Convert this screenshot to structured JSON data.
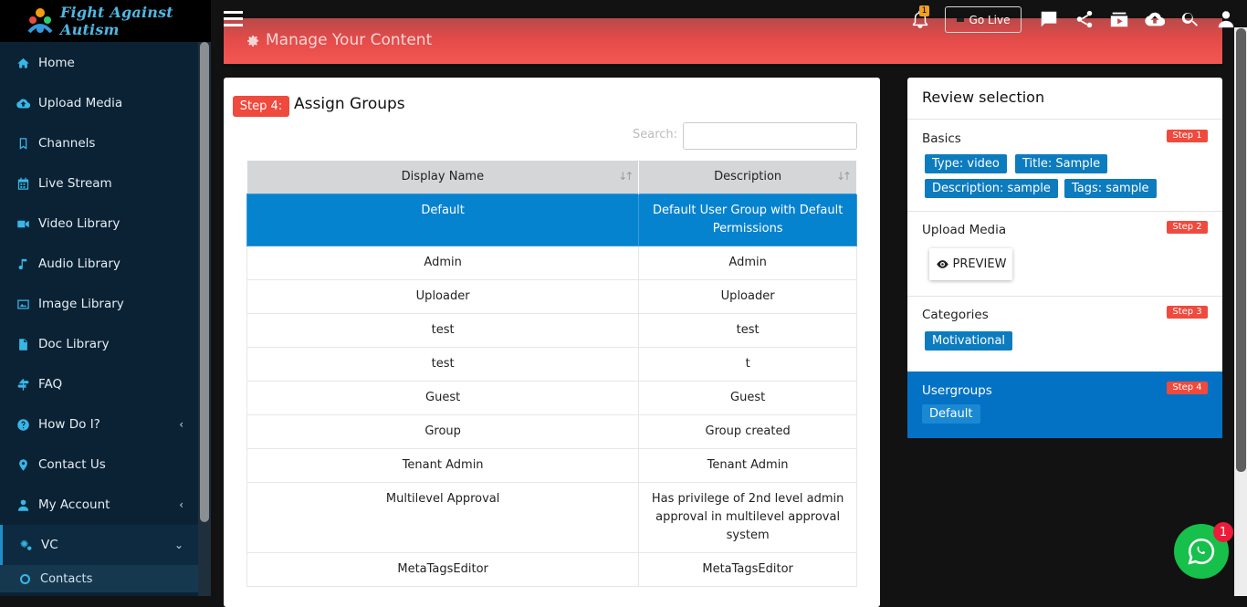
{
  "app": {
    "logo_text": "Fight Against Autism"
  },
  "sidebar": {
    "items": [
      {
        "label": "Home",
        "icon": "home-icon"
      },
      {
        "label": "Upload Media",
        "icon": "cloud-upload-icon"
      },
      {
        "label": "Channels",
        "icon": "bookmark-icon"
      },
      {
        "label": "Live Stream",
        "icon": "calendar-icon"
      },
      {
        "label": "Video Library",
        "icon": "video-camera-icon"
      },
      {
        "label": "Audio Library",
        "icon": "music-icon"
      },
      {
        "label": "Image Library",
        "icon": "image-icon"
      },
      {
        "label": "Doc Library",
        "icon": "document-icon"
      },
      {
        "label": "FAQ",
        "icon": "signpost-icon"
      },
      {
        "label": "How Do I?",
        "icon": "question-icon",
        "chevron": "‹"
      },
      {
        "label": "Contact Us",
        "icon": "map-marker-icon"
      },
      {
        "label": "My Account",
        "icon": "user-icon",
        "chevron": "‹"
      },
      {
        "label": "VC",
        "icon": "cogs-icon",
        "chevron": "⌄"
      }
    ],
    "sub_item": "Contacts"
  },
  "topbar": {
    "notification_count": "1",
    "go_live_label": "Go Live"
  },
  "header": {
    "title": "Manage Your Content"
  },
  "step": {
    "badge": "Step 4:",
    "title": "Assign Groups",
    "search_label": "Search:",
    "search_value": ""
  },
  "table": {
    "headers": [
      "Display Name",
      "Description"
    ],
    "rows": [
      {
        "name": "Default",
        "desc": "Default User Group with Default Permissions",
        "selected": true
      },
      {
        "name": "Admin",
        "desc": "Admin"
      },
      {
        "name": "Uploader",
        "desc": "Uploader"
      },
      {
        "name": "test",
        "desc": "test"
      },
      {
        "name": "test",
        "desc": "t"
      },
      {
        "name": "Guest",
        "desc": "Guest"
      },
      {
        "name": "Group",
        "desc": "Group created"
      },
      {
        "name": "Tenant Admin",
        "desc": "Tenant Admin"
      },
      {
        "name": "Multilevel Approval",
        "desc": "Has privilege of 2nd level admin approval in multilevel approval system"
      },
      {
        "name": "MetaTagsEditor",
        "desc": "MetaTagsEditor"
      }
    ]
  },
  "review": {
    "title": "Review selection",
    "basics": {
      "title": "Basics",
      "step": "Step 1",
      "tags": [
        "Type: video",
        "Title: Sample",
        "Description: sample",
        "Tags: sample"
      ]
    },
    "upload": {
      "title": "Upload Media",
      "step": "Step 2",
      "preview_label": "PREVIEW"
    },
    "categories": {
      "title": "Categories",
      "step": "Step 3",
      "tags": [
        "Motivational"
      ]
    },
    "usergroups": {
      "title": "Usergroups",
      "step": "Step 4",
      "tags": [
        "Default"
      ]
    }
  },
  "chat": {
    "badge": "1"
  },
  "colors": {
    "banner": "#f55752",
    "accent": "#0683cf",
    "sidebar": "#0b2235",
    "step_badge": "#ef4a3d",
    "chat": "#16c04b"
  }
}
